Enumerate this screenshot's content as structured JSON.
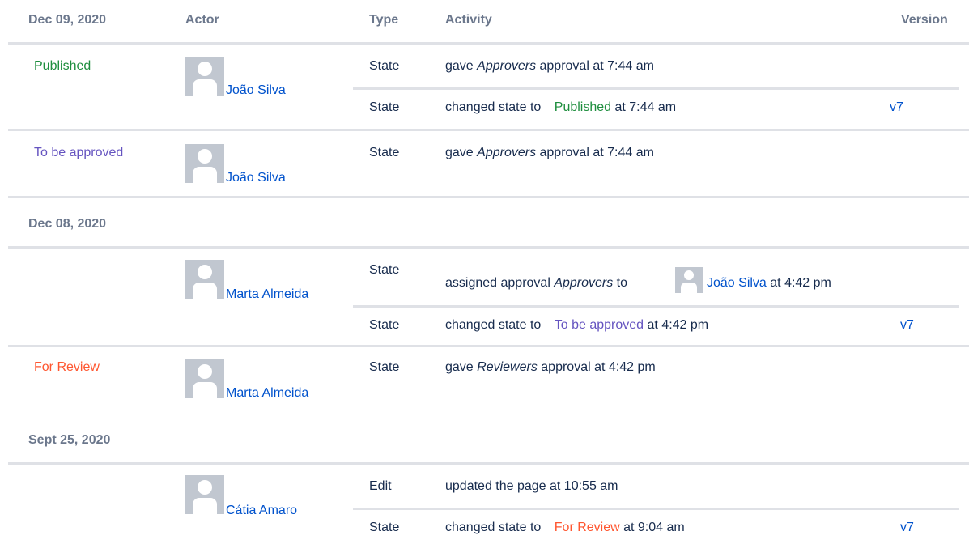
{
  "header": {
    "date": "Dec 09, 2020",
    "actor": "Actor",
    "type": "Type",
    "activity": "Activity",
    "version": "Version"
  },
  "groups": [
    {
      "state": "Published",
      "actor": "João Silva",
      "rows": [
        {
          "type": "State",
          "text_pre": "gave ",
          "text_em": "Approvers",
          "text_post": " approval at 7:44 am"
        },
        {
          "type": "State",
          "text_pre": "changed state to ",
          "state_label": "Published",
          "text_post": " at 7:44 am",
          "version": "v7"
        }
      ]
    },
    {
      "state": "To be approved",
      "actor": "João Silva",
      "rows": [
        {
          "type": "State",
          "text_pre": "gave ",
          "text_em": "Approvers",
          "text_post": " approval at 7:44 am"
        }
      ]
    },
    {
      "date": "Dec 08, 2020",
      "actor": "Marta Almeida",
      "rows": [
        {
          "type": "State",
          "text_pre": "assigned approval ",
          "text_em": "Approvers",
          "text_mid": " to ",
          "user": "João Silva",
          "text_post": " at 4:42 pm"
        },
        {
          "type": "State",
          "text_pre": "changed state to ",
          "state_label": "To be approved",
          "text_post": " at 4:42 pm",
          "version": "v7"
        }
      ]
    },
    {
      "state": "For Review",
      "actor": "Marta Almeida",
      "rows": [
        {
          "type": "State",
          "text_pre": "gave ",
          "text_em": "Reviewers",
          "text_post": " approval at 4:42 pm"
        }
      ]
    },
    {
      "date": "Sept 25, 2020",
      "actor": "Cátia Amaro",
      "rows": [
        {
          "type": "Edit",
          "text": "updated the page at 10:55 am"
        },
        {
          "type": "State",
          "text_pre": "changed state to ",
          "state_label": "For Review",
          "text_post": " at 9:04 am",
          "version": "v7"
        }
      ]
    }
  ],
  "colors": {
    "published": "#1e8e3e",
    "to_be_approved": "#6554c0",
    "for_review": "#ff5630",
    "link": "#0052cc"
  }
}
